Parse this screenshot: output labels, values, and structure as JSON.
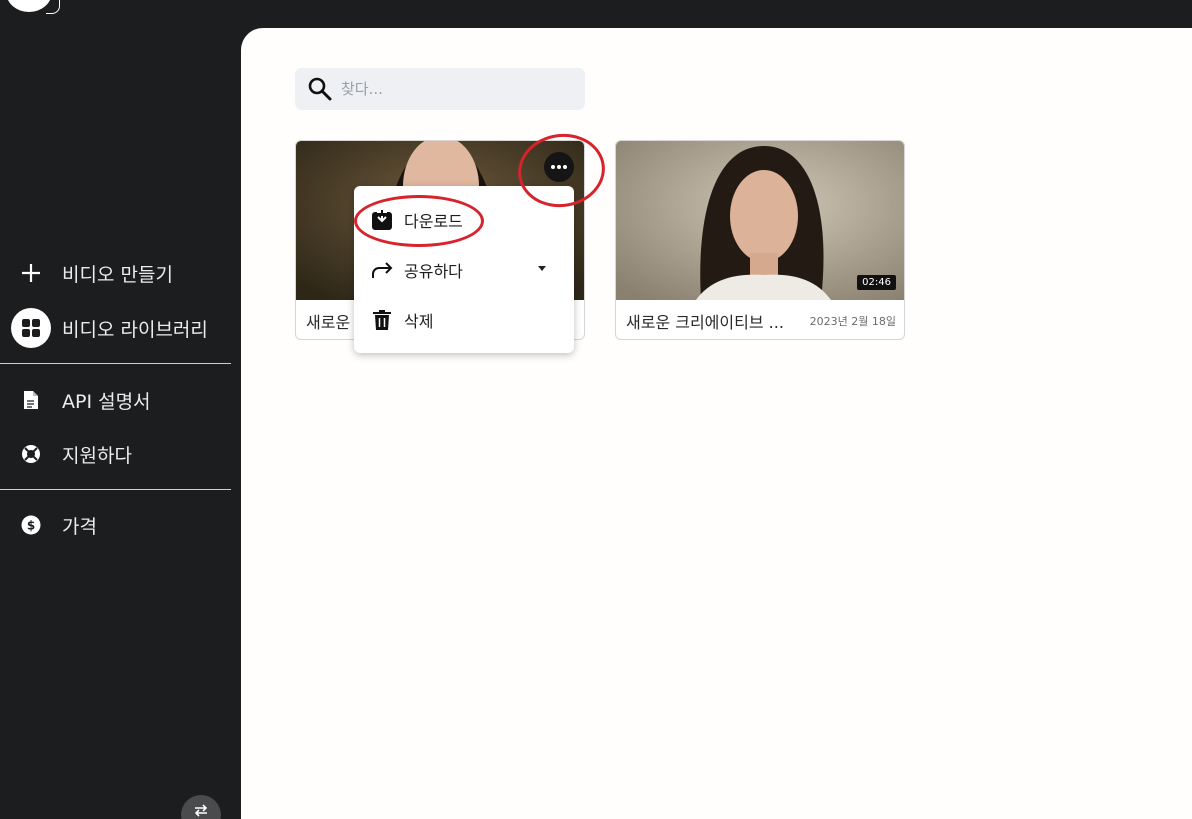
{
  "sidebar": {
    "items": [
      {
        "label": "비디오 만들기",
        "icon": "plus-icon"
      },
      {
        "label": "비디오 라이브러리",
        "icon": "grid-icon"
      },
      {
        "label": "API 설명서",
        "icon": "document-icon"
      },
      {
        "label": "지원하다",
        "icon": "lifebuoy-icon"
      },
      {
        "label": "가격",
        "icon": "dollar-icon"
      }
    ],
    "active_item": "비디오 라이브러리"
  },
  "search": {
    "placeholder": "찾다..."
  },
  "videos": [
    {
      "title": "새로운",
      "date": "",
      "duration": ""
    },
    {
      "title": "새로운 크리에이티브 ...",
      "date": "2023년 2월 18일",
      "duration": "02:46"
    }
  ],
  "context_menu": {
    "items": [
      {
        "label": "다운로드",
        "icon": "download-icon"
      },
      {
        "label": "공유하다",
        "icon": "share-icon"
      },
      {
        "label": "삭제",
        "icon": "trash-icon"
      }
    ]
  },
  "annotations": {
    "color": "#d6232c"
  },
  "colors": {
    "sidebar_bg": "#1c1d1f",
    "main_bg": "#fffefc",
    "search_bg": "#eef0f3"
  }
}
